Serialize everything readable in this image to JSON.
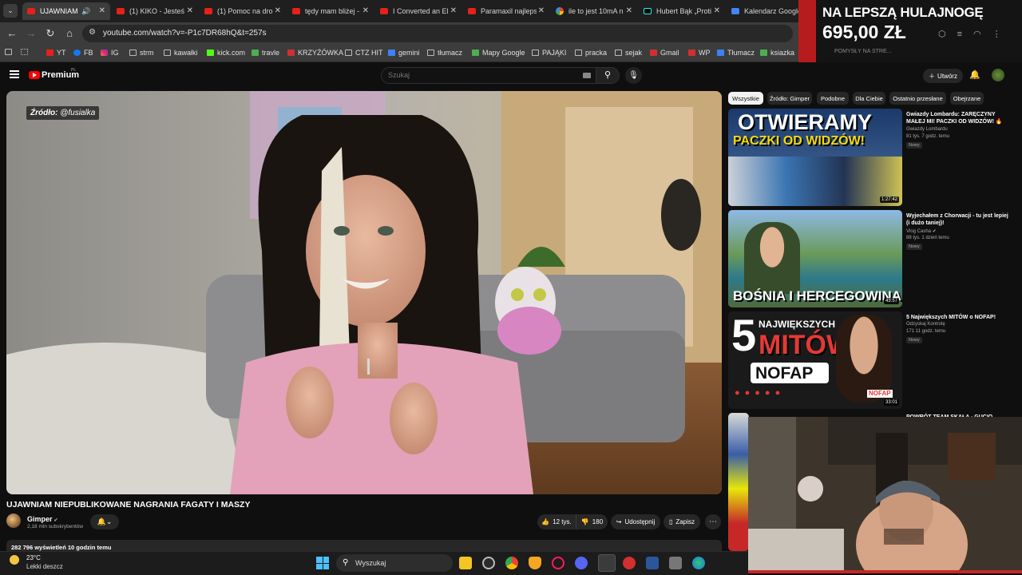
{
  "browser": {
    "tab_menu": "⌄",
    "tabs": [
      {
        "title": "UJAWNIAM N",
        "active": true
      },
      {
        "title": "(1) KIKO - Jesteś n",
        "active": false
      },
      {
        "title": "(1) Pomoc na dro",
        "active": false
      },
      {
        "title": "tędy mam bliżej -",
        "active": false
      },
      {
        "title": "I Converted an El",
        "active": false
      },
      {
        "title": "Paramaxil najleps",
        "active": false
      },
      {
        "title": "ile to jest 10mA n",
        "active": false
      },
      {
        "title": "Hubert Bąk „Proti",
        "active": false
      },
      {
        "title": "Kalendarz Google",
        "active": false
      }
    ],
    "url": "youtube.com/watch?v=-P1c7DR68hQ&t=257s",
    "bookmarks": [
      "YT",
      "FB",
      "IG",
      "strm",
      "kawałki",
      "kick.com",
      "travle",
      "KRZYŻÓWKA",
      "CTZ HIT",
      "gemini",
      "tłumacz",
      "Mapy Google",
      "PAJĄKI",
      "pracka",
      "sejak",
      "Gmail",
      "WP",
      "Tłumacz",
      "ksiazka"
    ]
  },
  "ad": {
    "line1": "NA LEPSZĄ HULAJNOGĘ",
    "line2": "695,00 ZŁ",
    "line3": "POMYSŁY NA STRE..."
  },
  "youtube": {
    "logo_text": "Premium",
    "logo_region": "PL",
    "search_placeholder": "Szukaj",
    "create_label": "Utwórz",
    "video": {
      "source_badge_prefix": "Źródło:",
      "source_badge_handle": "@fusialka",
      "title": "UJAWNIAM NIEPUBLIKOWANE NAGRANIA FAGATY I MASZY",
      "channel": "Gimper",
      "subscribers": "2,18 mln subskrybentów",
      "likes": "12 tys.",
      "dislikes": "180",
      "share_label": "Udostępnij",
      "save_label": "Zapisz",
      "views_line": "282 796 wyświetleń  10 godzin temu"
    },
    "chips": [
      "Wszystkie",
      "Źródło: Gimper",
      "Podobne",
      "Dla Ciebie",
      "Ostatnio przesłane",
      "Obejrzane"
    ],
    "recommendations": [
      {
        "title": "Gwiazdy Lombardu: ZARĘCZYNY MAŁEJ MI! PACZKI OD WIDZÓW! 🔥",
        "channel": "Gwiazdy Lombardu",
        "meta": "81 tys.  7 godz. temu",
        "badge": "Nowy",
        "duration": "1:27:42",
        "thumb_text_1": "OTWIERAMY",
        "thumb_text_2": "PACZKI OD WIDZÓW!"
      },
      {
        "title": "Wyjechałem z Chorwacji - tu jest lepiej (i dużo taniej)!",
        "channel": "Vlog Casha",
        "meta": "88 tys.  1 dzień temu",
        "badge": "Nowy",
        "duration": "43:57",
        "thumb_text_1": "BOŚNIA I HERCEGOWINA",
        "thumb_text_2": ""
      },
      {
        "title": "5 Największych MITÓW o NOFAP!",
        "channel": "Odzyskaj Kontrolę",
        "meta": "171  11 godz. temu",
        "badge": "Nowy",
        "duration": "33:01",
        "thumb_text_1": "5",
        "thumb_text_2": "NAJWIĘKSZYCH",
        "thumb_text_3": "MITÓW",
        "thumb_text_4": "NOFAP",
        "thumb_text_5": "NOFAP"
      },
      {
        "title": "POWRÓT TEAM SKAŁA - GUCIO",
        "channel": "",
        "meta": "",
        "badge": "",
        "duration": ""
      }
    ]
  },
  "taskbar": {
    "temperature": "23°C",
    "weather": "Lekki deszcz",
    "search_label": "Wyszukaj"
  },
  "colors": {
    "yt_red": "#ff0000",
    "background": "#0f0f0f",
    "surface": "#272727"
  }
}
